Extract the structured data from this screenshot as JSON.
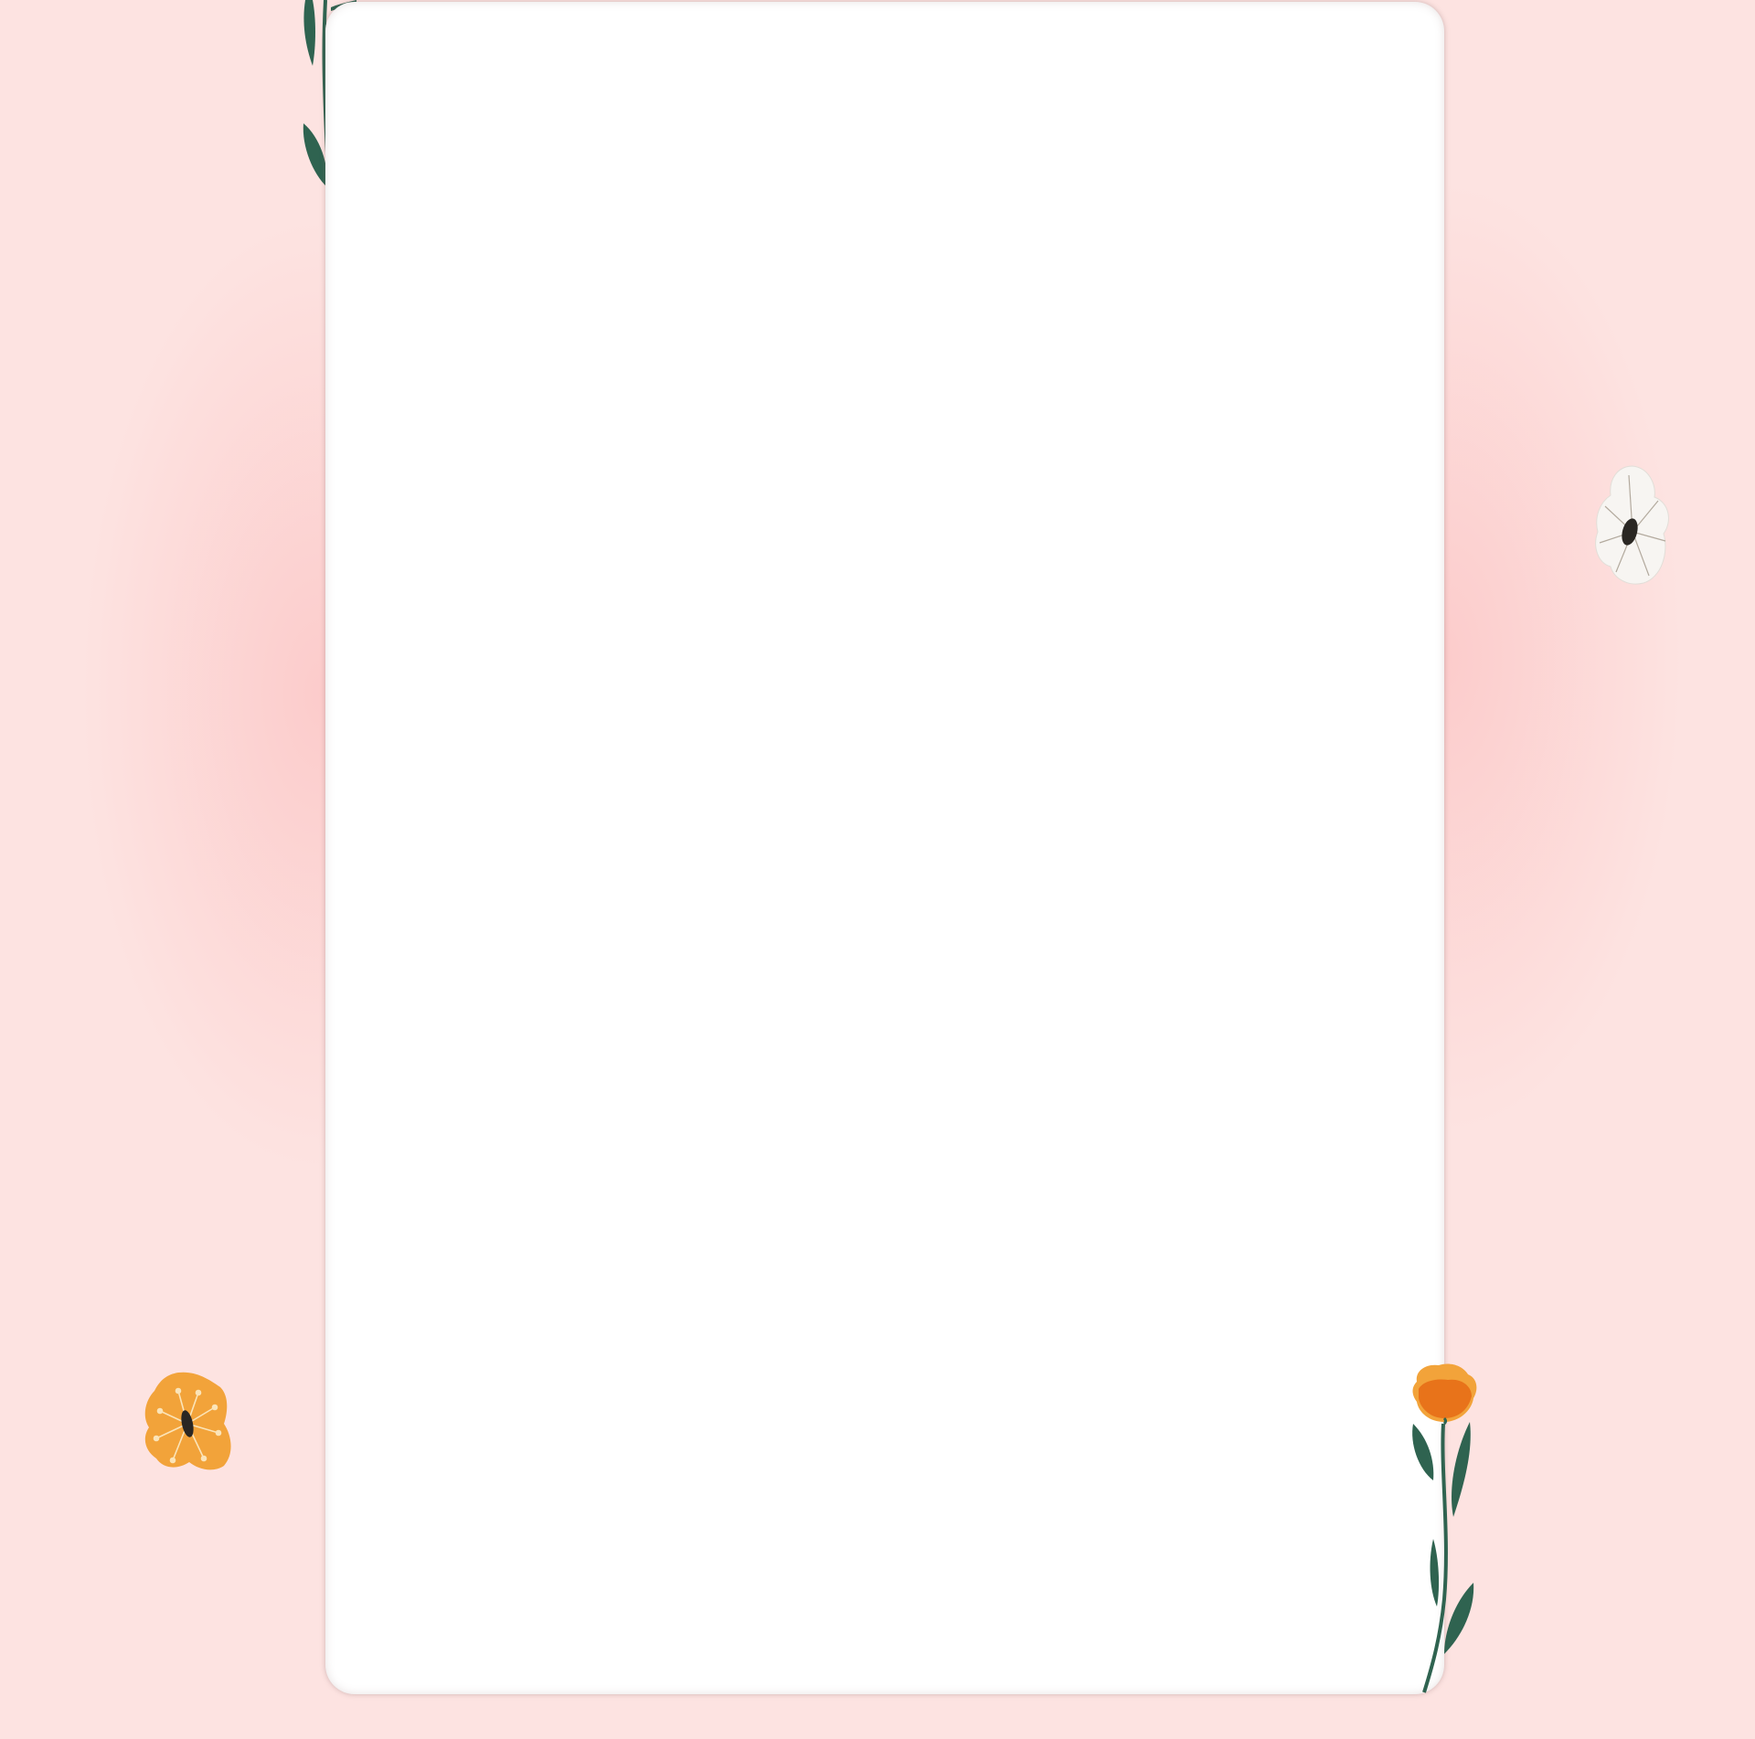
{
  "colors": {
    "background": "#fde3e1",
    "card": "#ffffff",
    "leaf": "#2f6350",
    "yellow_flower": "#f2a33a",
    "orange_flower": "#e8731a",
    "white_flower": "#f7f5f2",
    "flower_center": "#2a2723"
  },
  "icons": [
    "vine-leaves-icon",
    "white-flower-icon",
    "yellow-flower-icon",
    "orange-poppy-flower-icon"
  ]
}
